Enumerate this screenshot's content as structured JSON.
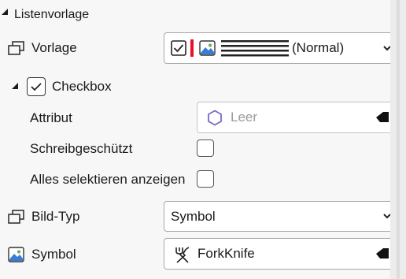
{
  "section": {
    "title": "Listenvorlage"
  },
  "vorlage": {
    "label": "Vorlage",
    "value": "(Normal)"
  },
  "checkbox_group": {
    "label": "Checkbox",
    "checked": true
  },
  "attribut": {
    "label": "Attribut",
    "placeholder": "Leer"
  },
  "schreibgeschuetzt": {
    "label": "Schreibgeschützt",
    "checked": false
  },
  "alles_selektieren": {
    "label": "Alles selektieren anzeigen",
    "checked": false
  },
  "bild_typ": {
    "label": "Bild-Typ",
    "value": "Symbol"
  },
  "symbol": {
    "label": "Symbol",
    "value": "ForkKnife"
  },
  "colors": {
    "accent_red": "#e81123",
    "hexagon": "#7b68c8",
    "placeholder": "#9a9a9a"
  }
}
